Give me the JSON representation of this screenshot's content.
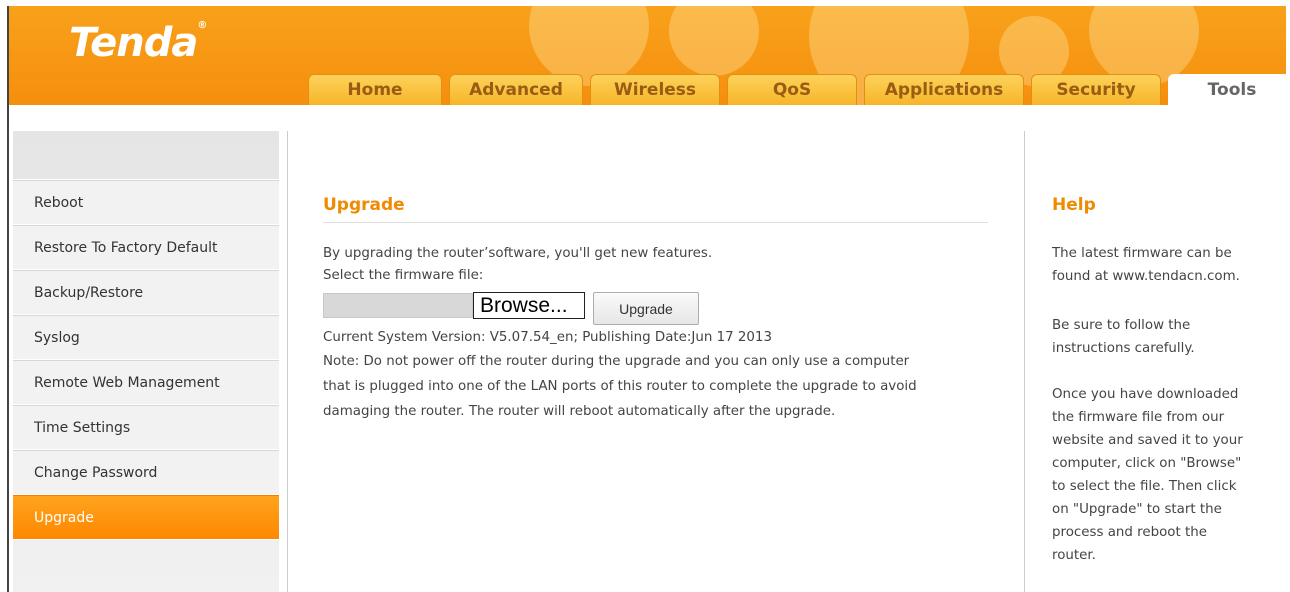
{
  "brand": {
    "logo": "Tenda",
    "logo_mark": "®"
  },
  "tabs": [
    {
      "label": "Home"
    },
    {
      "label": "Advanced"
    },
    {
      "label": "Wireless"
    },
    {
      "label": "QoS"
    },
    {
      "label": "Applications"
    },
    {
      "label": "Security"
    },
    {
      "label": "Tools"
    }
  ],
  "active_tab": "Tools",
  "sidebar": {
    "items": [
      {
        "label": "Reboot"
      },
      {
        "label": "Restore To Factory Default"
      },
      {
        "label": "Backup/Restore"
      },
      {
        "label": "Syslog"
      },
      {
        "label": "Remote Web Management"
      },
      {
        "label": "Time Settings"
      },
      {
        "label": "Change Password"
      },
      {
        "label": "Upgrade"
      }
    ],
    "active_item": "Upgrade"
  },
  "main": {
    "title": "Upgrade",
    "intro": "By upgrading the router’software, you'll get new features.",
    "select_label": "Select the firmware file:",
    "browse_label": "Browse...",
    "upgrade_label": "Upgrade",
    "version_text": "Current System Version: V5.07.54_en; Publishing Date:Jun 17 2013",
    "note_lines": [
      "Note: Do not power off the router during the upgrade and you can only use a computer",
      "that is plugged into one of the LAN ports of this router to complete the upgrade to avoid",
      "damaging the router. The router will reboot automatically after the upgrade."
    ]
  },
  "help": {
    "title": "Help",
    "lines": [
      "The latest firmware can be",
      "found at www.tendacn.com.",
      "",
      "Be sure to follow the",
      "instructions carefully.",
      "",
      "Once you have downloaded",
      "the firmware file from our",
      "website and saved it to your",
      "computer, click on \"Browse\"",
      "to select the file. Then click",
      "on \"Upgrade\" to start the",
      "process and reboot the",
      "router."
    ]
  },
  "colors": {
    "accent": "#f08a00",
    "header": "#f7951a",
    "active_item": "#ff8f00"
  }
}
